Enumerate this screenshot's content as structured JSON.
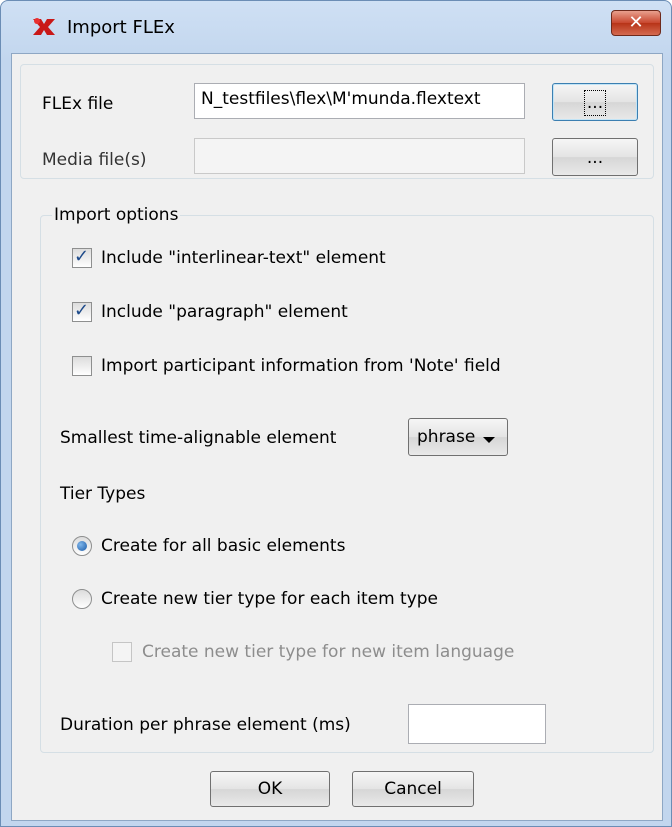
{
  "window": {
    "title": "Import FLEx",
    "close_label": "✕"
  },
  "files": {
    "flex_label": "FLEx file",
    "flex_value": "N_testfiles\\flex\\M'munda.flextext",
    "flex_browse": "...",
    "media_label": "Media file(s)",
    "media_value": "",
    "media_browse": "..."
  },
  "options": {
    "title": "Import options",
    "include_interlinear": {
      "label": "Include \"interlinear-text\" element",
      "checked": true
    },
    "include_paragraph": {
      "label": "Include \"paragraph\" element",
      "checked": true
    },
    "import_participant": {
      "label": "Import participant information from 'Note' field",
      "checked": false
    },
    "smallest_label": "Smallest time-alignable element",
    "smallest_value": "phrase",
    "tier_types_label": "Tier Types",
    "tier_all_basic": {
      "label": "Create for all basic elements",
      "selected": true
    },
    "tier_each_item": {
      "label": "Create new tier type for each item type",
      "selected": false
    },
    "tier_new_language": {
      "label": "Create new tier type for new item language",
      "checked": false,
      "enabled": false
    },
    "duration_label": "Duration per phrase element (ms)",
    "duration_value": ""
  },
  "footer": {
    "ok": "OK",
    "cancel": "Cancel"
  }
}
